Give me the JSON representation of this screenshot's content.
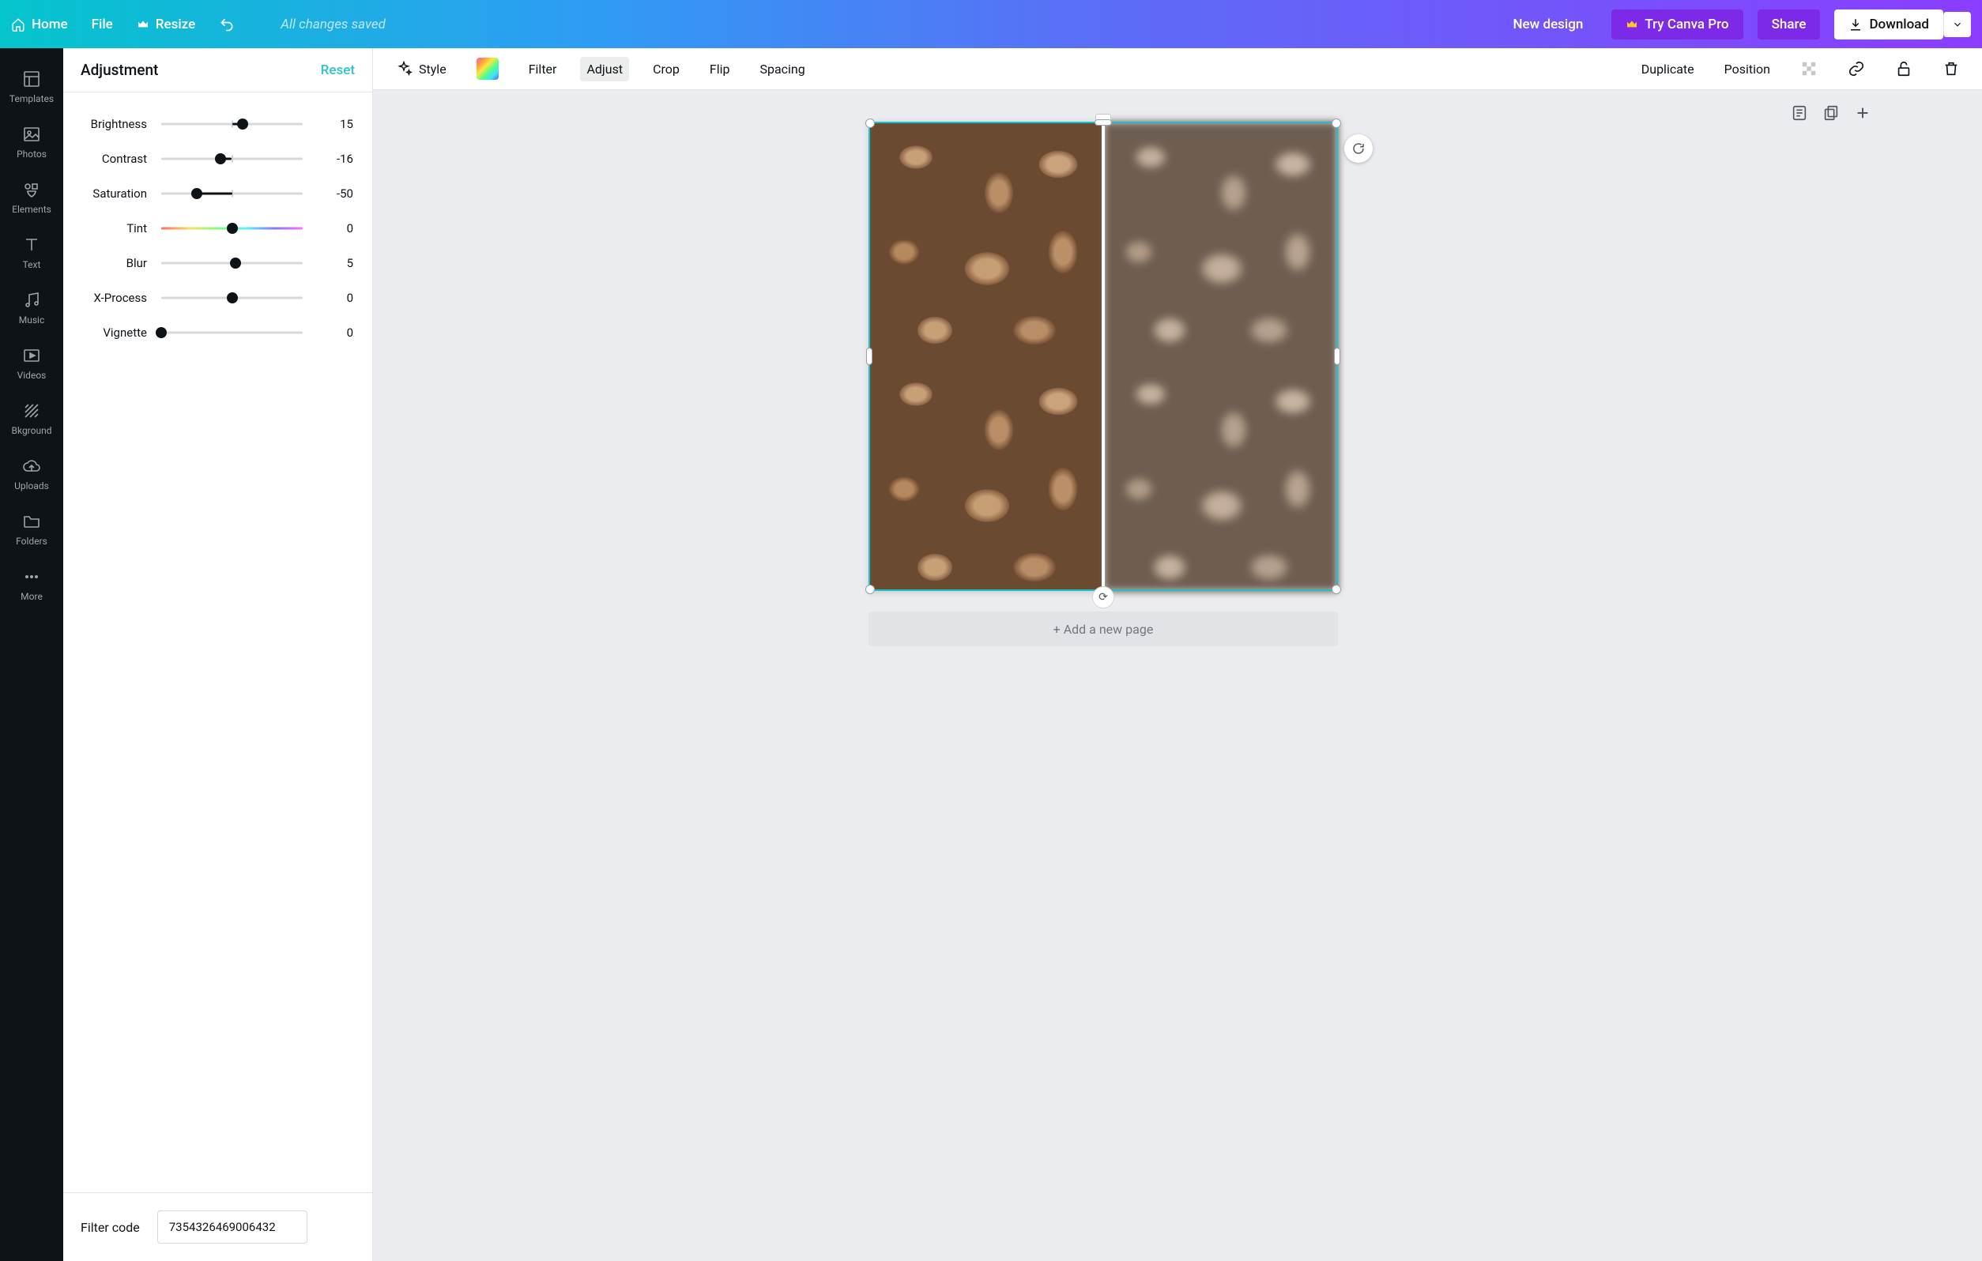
{
  "topbar": {
    "home": "Home",
    "file": "File",
    "resize": "Resize",
    "status": "All changes saved",
    "new_design": "New design",
    "try_pro": "Try Canva Pro",
    "share": "Share",
    "download": "Download"
  },
  "rail": [
    {
      "id": "templates",
      "label": "Templates"
    },
    {
      "id": "photos",
      "label": "Photos"
    },
    {
      "id": "elements",
      "label": "Elements"
    },
    {
      "id": "text",
      "label": "Text"
    },
    {
      "id": "music",
      "label": "Music"
    },
    {
      "id": "videos",
      "label": "Videos"
    },
    {
      "id": "bkground",
      "label": "Bkground"
    },
    {
      "id": "uploads",
      "label": "Uploads"
    },
    {
      "id": "folders",
      "label": "Folders"
    },
    {
      "id": "more",
      "label": "More"
    }
  ],
  "panel": {
    "title": "Adjustment",
    "reset": "Reset",
    "sliders": [
      {
        "id": "brightness",
        "label": "Brightness",
        "value": 15,
        "min": -100,
        "max": 100,
        "centered": true,
        "rainbow": false
      },
      {
        "id": "contrast",
        "label": "Contrast",
        "value": -16,
        "min": -100,
        "max": 100,
        "centered": true,
        "rainbow": false
      },
      {
        "id": "saturation",
        "label": "Saturation",
        "value": -50,
        "min": -100,
        "max": 100,
        "centered": true,
        "rainbow": false
      },
      {
        "id": "tint",
        "label": "Tint",
        "value": 0,
        "min": -100,
        "max": 100,
        "centered": true,
        "rainbow": true
      },
      {
        "id": "blur",
        "label": "Blur",
        "value": 5,
        "min": -100,
        "max": 100,
        "centered": true,
        "rainbow": false
      },
      {
        "id": "xprocess",
        "label": "X-Process",
        "value": 0,
        "min": -100,
        "max": 100,
        "centered": true,
        "rainbow": false
      },
      {
        "id": "vignette",
        "label": "Vignette",
        "value": 0,
        "min": 0,
        "max": 100,
        "centered": false,
        "rainbow": false
      }
    ],
    "filter_code_label": "Filter code",
    "filter_code": "7354326469006432"
  },
  "ctxbar": {
    "style": "Style",
    "filter": "Filter",
    "adjust": "Adjust",
    "crop": "Crop",
    "flip": "Flip",
    "spacing": "Spacing",
    "duplicate": "Duplicate",
    "position": "Position"
  },
  "canvas": {
    "add_page": "+ Add a new page"
  }
}
